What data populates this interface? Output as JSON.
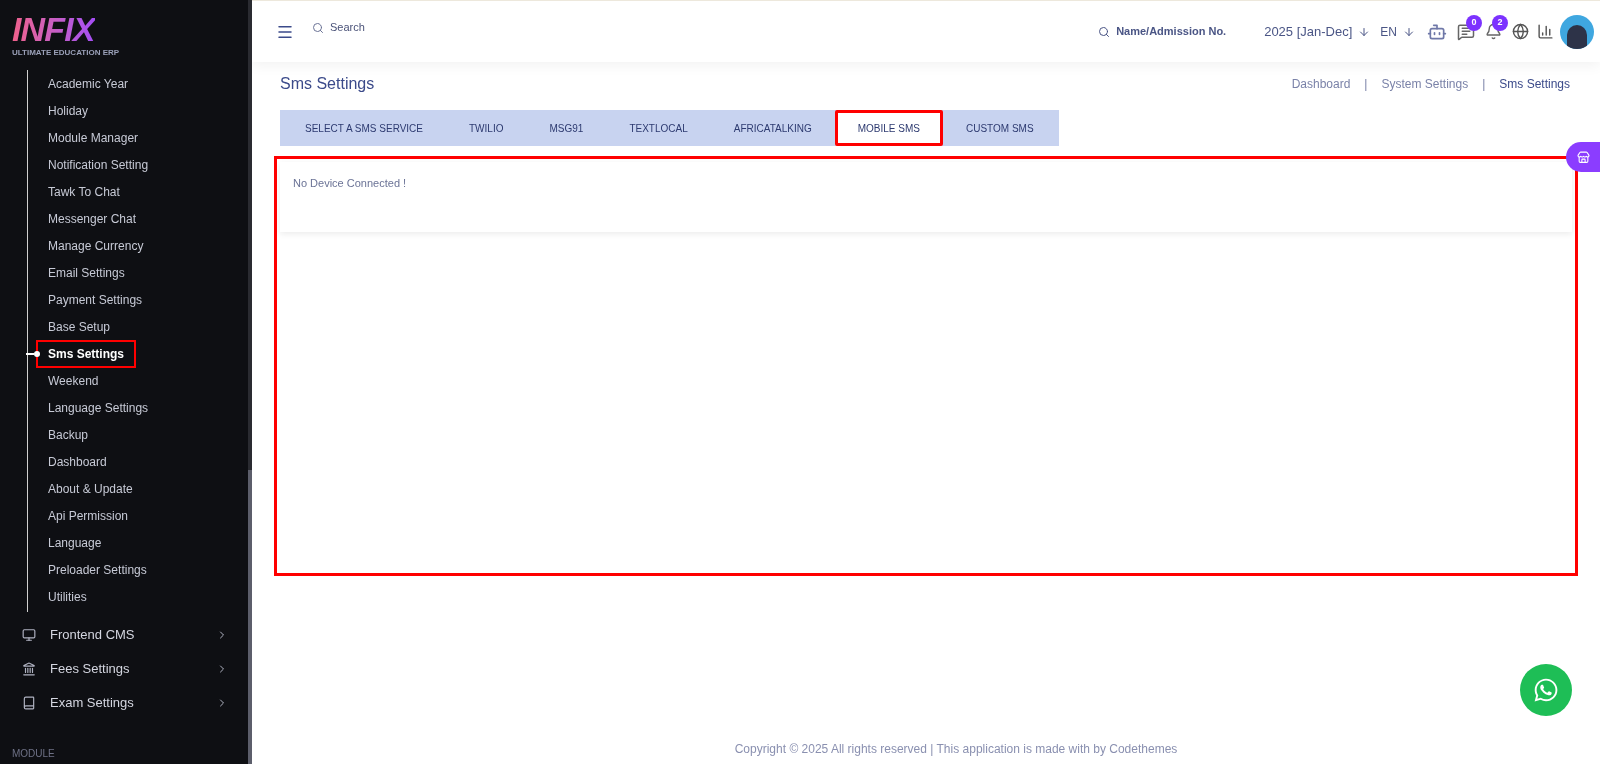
{
  "logo": {
    "name": "INFIX",
    "tagline": "ULTIMATE EDUCATION ERP"
  },
  "sidebar": {
    "subitems": [
      {
        "label": "Academic Year",
        "selected": false,
        "highlighted": false
      },
      {
        "label": "Holiday",
        "selected": false,
        "highlighted": false
      },
      {
        "label": "Module Manager",
        "selected": false,
        "highlighted": false
      },
      {
        "label": "Notification Setting",
        "selected": false,
        "highlighted": false
      },
      {
        "label": "Tawk To Chat",
        "selected": false,
        "highlighted": false
      },
      {
        "label": "Messenger Chat",
        "selected": false,
        "highlighted": false
      },
      {
        "label": "Manage Currency",
        "selected": false,
        "highlighted": false
      },
      {
        "label": "Email Settings",
        "selected": false,
        "highlighted": false
      },
      {
        "label": "Payment Settings",
        "selected": false,
        "highlighted": false
      },
      {
        "label": "Base Setup",
        "selected": false,
        "highlighted": false
      },
      {
        "label": "Sms Settings",
        "selected": true,
        "highlighted": true
      },
      {
        "label": "Weekend",
        "selected": false,
        "highlighted": false
      },
      {
        "label": "Language Settings",
        "selected": false,
        "highlighted": false
      },
      {
        "label": "Backup",
        "selected": false,
        "highlighted": false
      },
      {
        "label": "Dashboard",
        "selected": false,
        "highlighted": false
      },
      {
        "label": "About & Update",
        "selected": false,
        "highlighted": false
      },
      {
        "label": "Api Permission",
        "selected": false,
        "highlighted": false
      },
      {
        "label": "Language",
        "selected": false,
        "highlighted": false
      },
      {
        "label": "Preloader Settings",
        "selected": false,
        "highlighted": false
      },
      {
        "label": "Utilities",
        "selected": false,
        "highlighted": false
      }
    ],
    "items": [
      {
        "label": "Frontend CMS",
        "kind": "monitor"
      },
      {
        "label": "Fees Settings",
        "kind": "bank"
      },
      {
        "label": "Exam Settings",
        "kind": "book"
      }
    ],
    "section_label": "MODULE"
  },
  "topbar": {
    "search": {
      "placeholder": "Search"
    },
    "student_search": {
      "placeholder": "Name/Admission No."
    },
    "session": "2025 [Jan-Dec]",
    "language": "EN",
    "messages_count": "0",
    "notifications_count": "2"
  },
  "page": {
    "title": "Sms Settings",
    "breadcrumbs": [
      "Dashboard",
      "System Settings",
      "Sms Settings"
    ],
    "breadcrumb_separator": "|",
    "tabs": [
      {
        "label": "SELECT A SMS SERVICE",
        "selected": false,
        "highlighted": false
      },
      {
        "label": "TWILIO",
        "selected": false,
        "highlighted": false
      },
      {
        "label": "MSG91",
        "selected": false,
        "highlighted": false
      },
      {
        "label": "TEXTLOCAL",
        "selected": false,
        "highlighted": false
      },
      {
        "label": "AFRICATALKING",
        "selected": false,
        "highlighted": false
      },
      {
        "label": "MOBILE SMS",
        "selected": true,
        "highlighted": true
      },
      {
        "label": "CUSTOM SMS",
        "selected": false,
        "highlighted": false
      }
    ],
    "message": "No Device Connected !",
    "panel_highlighted": true
  },
  "footer": "Copyright © 2025 All rights reserved | This application is made with by Codethemes"
}
